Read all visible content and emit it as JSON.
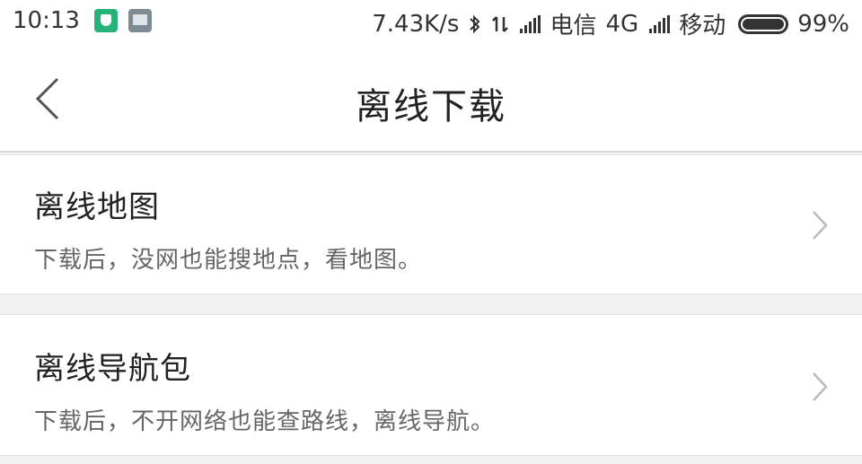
{
  "status_bar": {
    "time": "10:13",
    "net_speed": "7.43K/s",
    "carrier1": "电信",
    "network1": "4G",
    "carrier2": "移动",
    "battery": "99%",
    "icons": [
      "security-shield-icon",
      "app-notification-icon",
      "bluetooth-icon",
      "data-transfer-icon",
      "signal-icon",
      "battery-icon"
    ]
  },
  "header": {
    "title": "离线下载",
    "back_icon": "back-arrow-icon"
  },
  "items": [
    {
      "title": "离线地图",
      "description": "下载后，没网也能搜地点，看地图。",
      "icon": "chevron-right-icon"
    },
    {
      "title": "离线导航包",
      "description": "下载后，不开网络也能查路线，离线导航。",
      "icon": "chevron-right-icon"
    }
  ],
  "colors": {
    "background": "#f1f1f1",
    "card": "#ffffff",
    "shield": "#27b27a"
  }
}
